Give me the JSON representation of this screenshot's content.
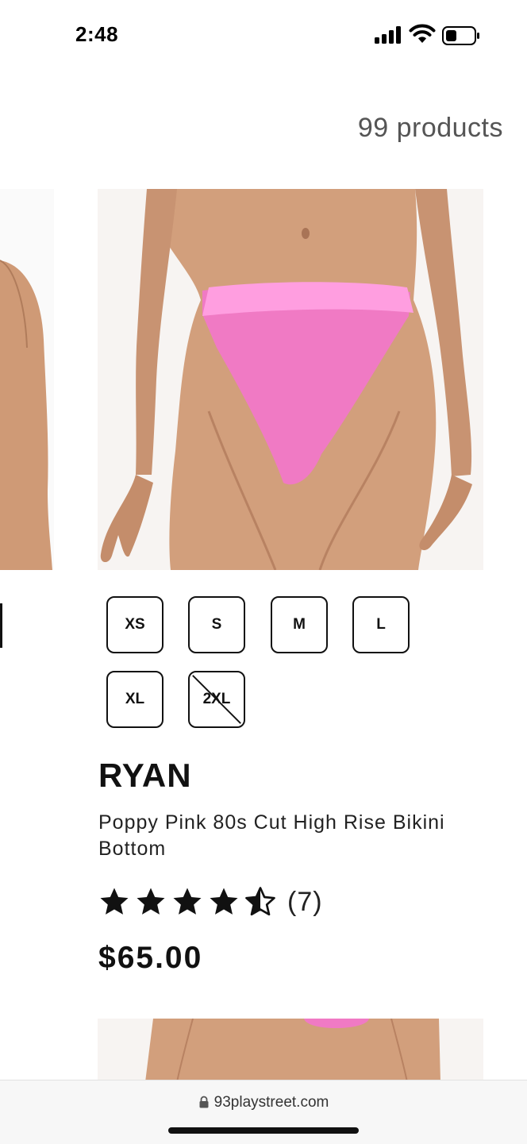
{
  "status_bar": {
    "time": "2:48"
  },
  "listing": {
    "product_count": "99 products"
  },
  "product": {
    "sizes": [
      {
        "label": "XS",
        "available": true
      },
      {
        "label": "S",
        "available": true
      },
      {
        "label": "M",
        "available": true
      },
      {
        "label": "L",
        "available": true
      },
      {
        "label": "XL",
        "available": true
      },
      {
        "label": "2XL",
        "available": false
      }
    ],
    "brand": "RYAN",
    "title": "Poppy Pink 80s Cut High Rise Bikini Bottom",
    "rating": {
      "value": 4.5,
      "max": 5,
      "count_text": "(7)"
    },
    "price": "$65.00",
    "colors": {
      "swimsuit": "#f07ac4",
      "waistband": "#ff9ee0",
      "skin": "#cf9a76"
    }
  },
  "browser": {
    "url": "93playstreet.com"
  }
}
